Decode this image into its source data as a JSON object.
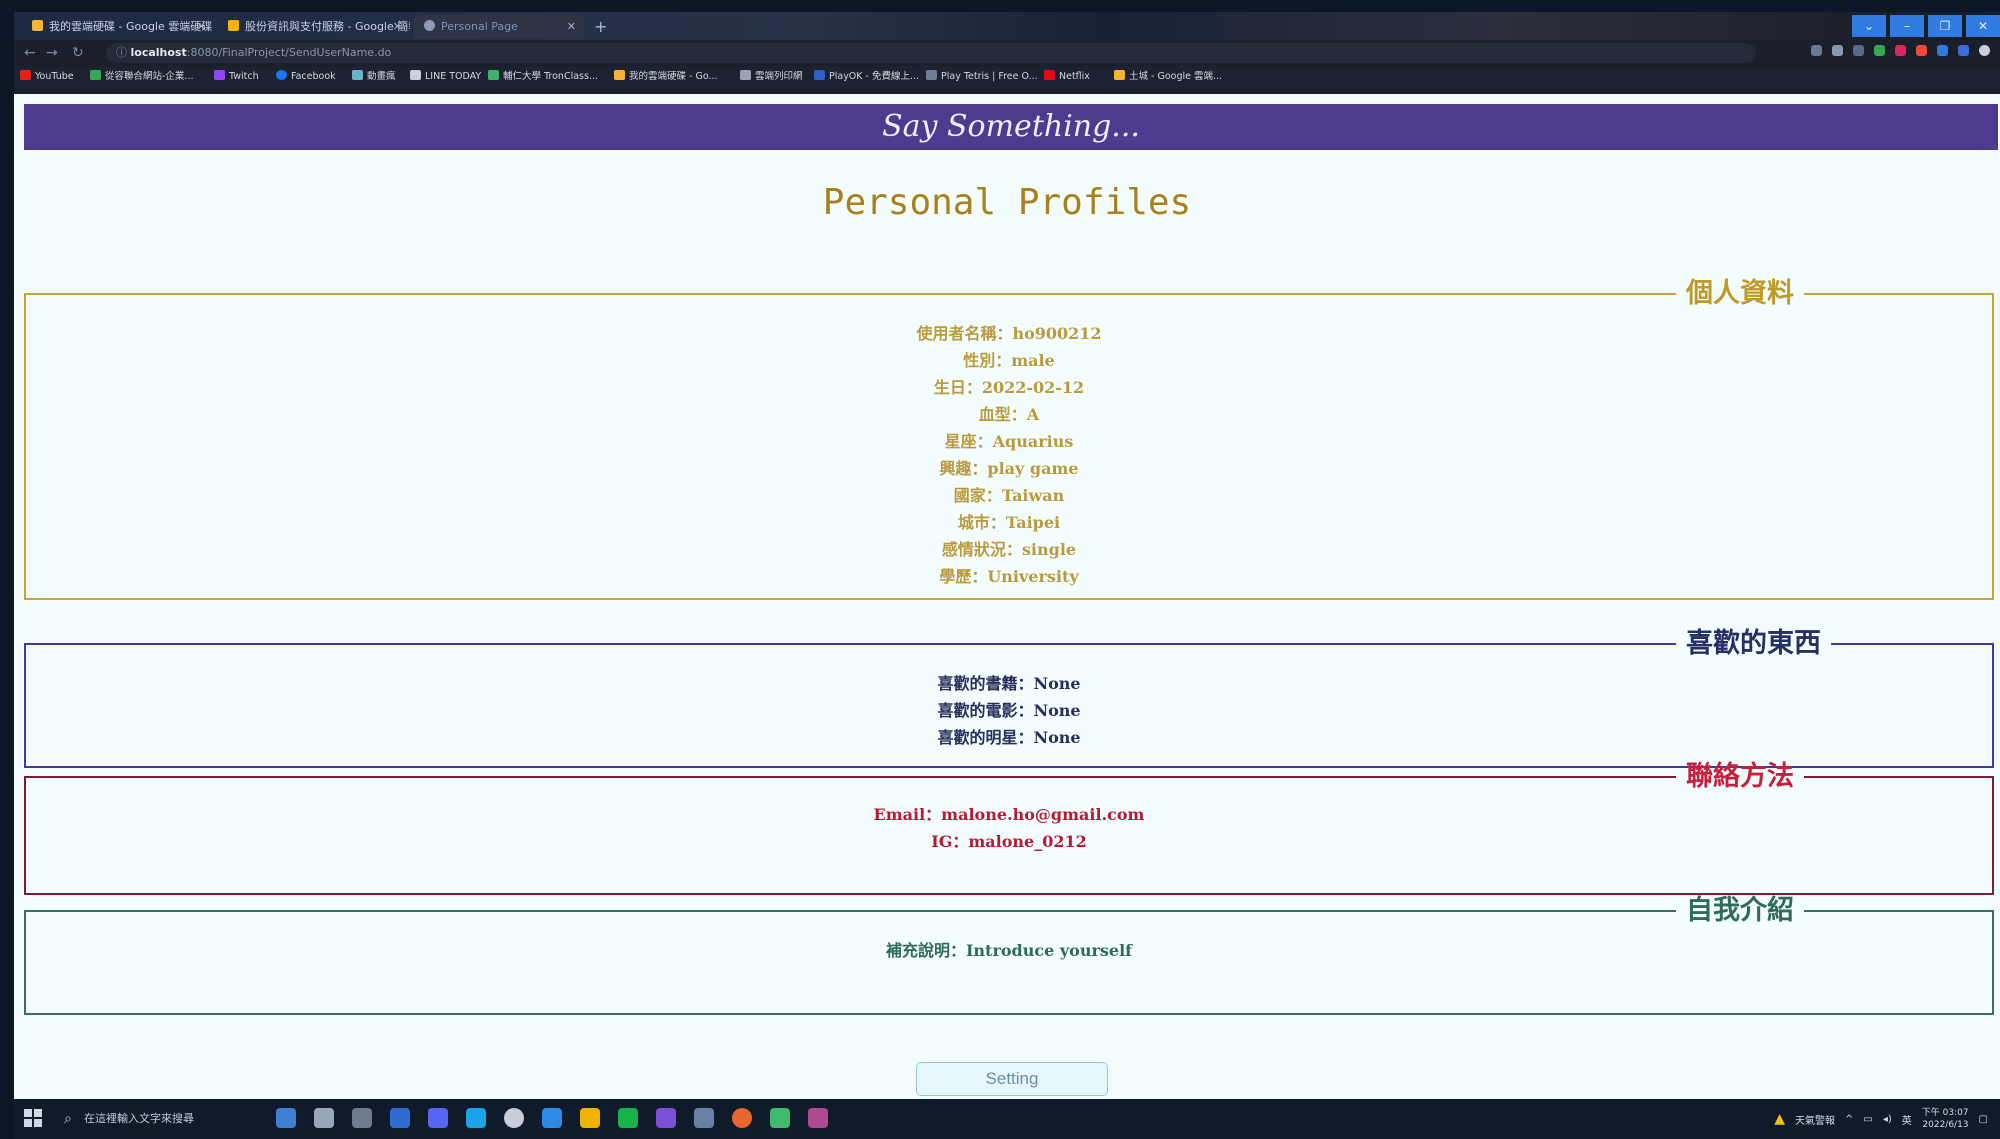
{
  "browser": {
    "tabs": [
      {
        "label": "我的雲端硬碟 - Google 雲端硬碟",
        "color": "#f2b632"
      },
      {
        "label": "股份資訊與支付服務 - Google 簡報",
        "color": "#f4b400"
      },
      {
        "label": "Personal Page",
        "color": "#8f9bb3"
      }
    ],
    "new_tab": "+",
    "window_buttons": [
      "⌄",
      "–",
      "❐",
      "✕"
    ],
    "url_host": "localhost",
    "url_rest": ":8080/FinalProject/SendUserName.do",
    "bookmarks": [
      {
        "label": "YouTube",
        "color": "#e62117"
      },
      {
        "label": "從容聯合網站-企業...",
        "color": "#34a853"
      },
      {
        "label": "Twitch",
        "color": "#9146ff"
      },
      {
        "label": "Facebook",
        "color": "#1877f2"
      },
      {
        "label": "動畫瘋",
        "color": "#6ab4c9"
      },
      {
        "label": "LINE TODAY",
        "color": "#c8d0dc"
      },
      {
        "label": "輔仁大學 TronClass...",
        "color": "#3db36b"
      },
      {
        "label": "我的雲端硬碟 - Go...",
        "color": "#f2b632"
      },
      {
        "label": "雲端列印網",
        "color": "#9aa3b2"
      },
      {
        "label": "PlayOK - 免費線上...",
        "color": "#2f62c9"
      },
      {
        "label": "Play Tetris | Free O...",
        "color": "#6f7d96"
      },
      {
        "label": "Netflix",
        "color": "#e50914"
      },
      {
        "label": "土城 - Google 雲端...",
        "color": "#f2b632"
      }
    ]
  },
  "page": {
    "banner": "Say Something...",
    "title": "Personal Profiles",
    "sections": {
      "profile": {
        "legend": "個人資料",
        "lines": [
          "使用者名稱：ho900212",
          "性別：male",
          "生日：2022-02-12",
          "血型：A",
          "星座：Aquarius",
          "興趣：play game",
          "國家：Taiwan",
          "城市：Taipei",
          "感情狀況：single",
          "學歷：University"
        ]
      },
      "likes": {
        "legend": "喜歡的東西",
        "lines": [
          "喜歡的書籍：None",
          "喜歡的電影：None",
          "喜歡的明星：None"
        ]
      },
      "contact": {
        "legend": "聯絡方法",
        "lines": [
          "Email：malone.ho@gmail.com",
          "IG：malone_0212"
        ]
      },
      "intro": {
        "legend": "自我介紹",
        "lines": [
          "補充說明：Introduce yourself"
        ]
      }
    },
    "setting_button": "Setting"
  },
  "taskbar": {
    "search_placeholder": "在這裡輸入文字來搜尋",
    "weather": "天氣警報",
    "ime": "英",
    "time": "下午 03:07",
    "date": "2022/6/13"
  },
  "colors": {
    "banner": "#4c3b8e",
    "profile": "#c09a26",
    "likes": "#263066",
    "contact": "#c4213c",
    "intro": "#2e6a5e"
  }
}
